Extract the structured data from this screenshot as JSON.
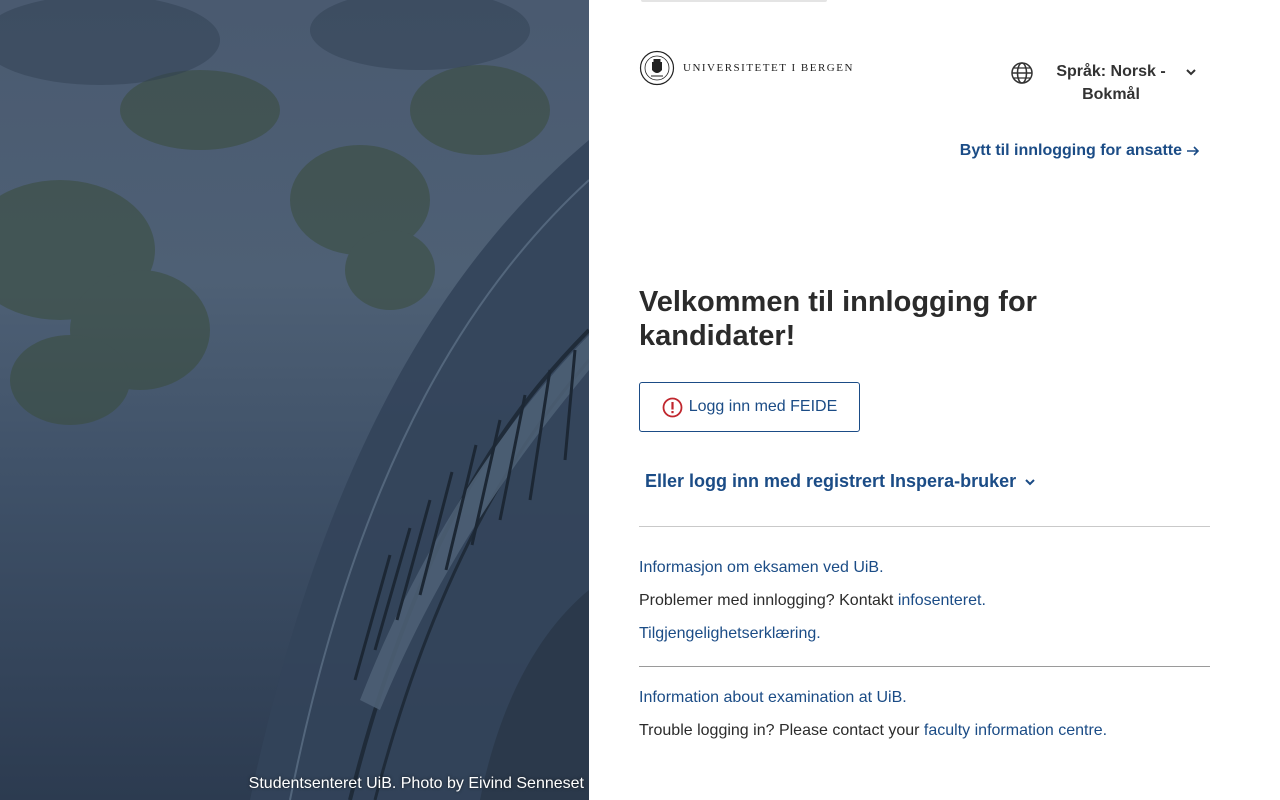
{
  "photo": {
    "caption": "Studentsenteret UiB. Photo by Eivind Senneset"
  },
  "header": {
    "logo_text": "UNIVERSITETET I BERGEN",
    "language_label": "Språk: Norsk - Bokmål",
    "staff_login_link": "Bytt til innlogging for ansatte"
  },
  "main": {
    "welcome_heading": "Velkommen til innlogging for kandidater!",
    "feide_button": "Logg inn med FEIDE",
    "inspera_toggle": "Eller logg inn med registrert Inspera-bruker"
  },
  "info_no": {
    "exam_info_link": "Informasjon om eksamen ved UiB",
    "exam_info_suffix": ".",
    "problems_text": "Problemer med innlogging? Kontakt ",
    "infocenter_link": "infosenteret",
    "problems_suffix": ".",
    "accessibility_link": "Tilgjengelighetserklæring",
    "accessibility_suffix": "."
  },
  "info_en": {
    "exam_info_link": "Information about examination at UiB",
    "exam_info_suffix": ".",
    "trouble_text": "Trouble logging in? Please contact your ",
    "faculty_link": "faculty information centre",
    "trouble_suffix": "."
  },
  "colors": {
    "link": "#1b4c86",
    "alert": "#c0262d",
    "photo_tint": "#3f5168"
  }
}
